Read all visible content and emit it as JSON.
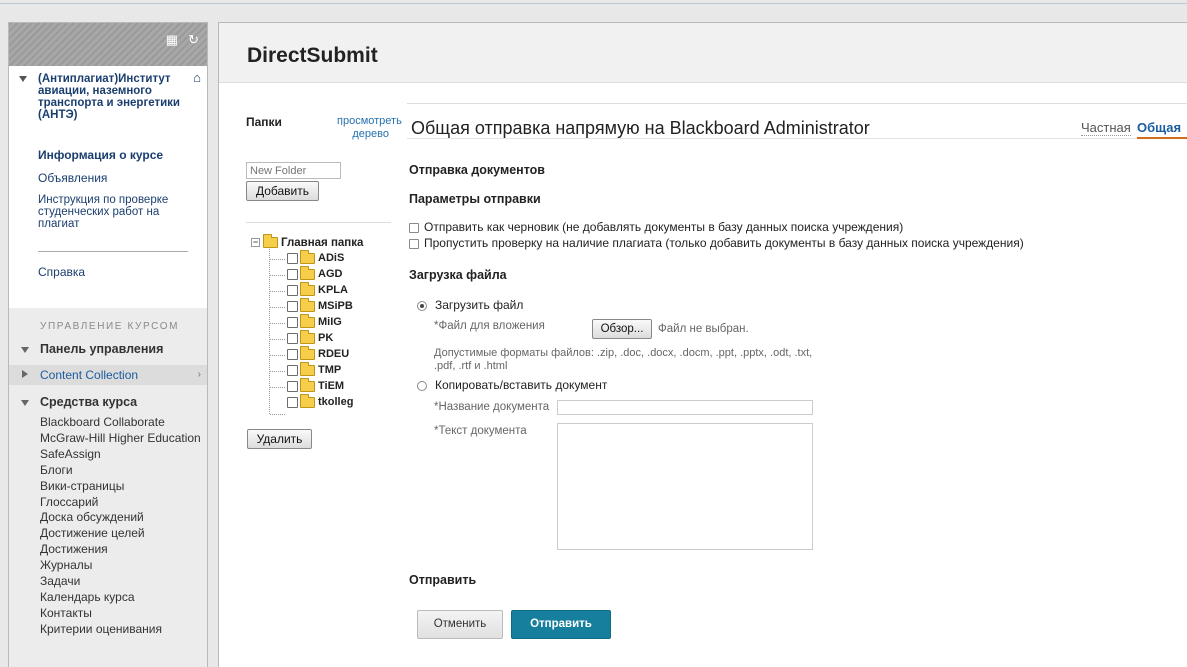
{
  "sidebar": {
    "course_title": "(Антиплагиат)Институт авиации, наземного транспорта и энергетики (АНТЭ)",
    "links": [
      {
        "label": "Информация о курсе",
        "bold": true
      },
      {
        "label": "Объявления",
        "bold": false
      },
      {
        "label": "Инструкция по проверке студенческих работ на плагиат",
        "bold": false
      }
    ],
    "help": "Справка",
    "management_title": "УПРАВЛЕНИЕ КУРСОМ",
    "control_panel": "Панель управления",
    "content_collection": "Content Collection",
    "course_tools": "Средства курса",
    "tools": [
      "Blackboard Collaborate",
      "McGraw-Hill Higher Education",
      "SafeAssign",
      "Блоги",
      "Вики-страницы",
      "Глоссарий",
      "Доска обсуждений",
      "Достижение целей",
      "Достижения",
      "Журналы",
      "Задачи",
      "Календарь курса",
      "Контакты",
      "Критерии оценивания"
    ]
  },
  "main": {
    "title": "DirectSubmit",
    "folders_label": "Папки",
    "view_tree": "просмотреть дерево",
    "new_folder_placeholder": "New Folder",
    "add_button": "Добавить",
    "delete_button": "Удалить",
    "tree_root": "Главная папка",
    "folders": [
      "ADiS",
      "AGD",
      "KPLA",
      "MSiPB",
      "MiIG",
      "PK",
      "RDEU",
      "TMP",
      "TiEM",
      "tkolleg"
    ]
  },
  "form": {
    "title": "Общая отправка напрямую на Blackboard Administrator",
    "tab_private": "Частная",
    "tab_public": "Общая",
    "section_docs": "Отправка документов",
    "section_params": "Параметры отправки",
    "opt_draft": "Отправить как черновик (не добавлять документы в базу данных поиска учреждения)",
    "opt_skip": "Пропустить проверку на наличие плагиата (только добавить документы в базу данных поиска учреждения)",
    "section_upload": "Загрузка файла",
    "radio_upload": "Загрузить файл",
    "attach_label": "*Файл для вложения",
    "browse_button": "Обзор...",
    "no_file": "Файл не выбран.",
    "formats_hint": "Допустимые форматы файлов: .zip, .doc, .docx, .docm, .ppt, .pptx, .odt, .txt, .pdf, .rtf и .html",
    "radio_paste": "Копировать/вставить документ",
    "doc_name_label": "*Название документа",
    "doc_text_label": "*Текст документа",
    "section_submit": "Отправить",
    "cancel_button": "Отменить",
    "submit_button": "Отправить"
  }
}
